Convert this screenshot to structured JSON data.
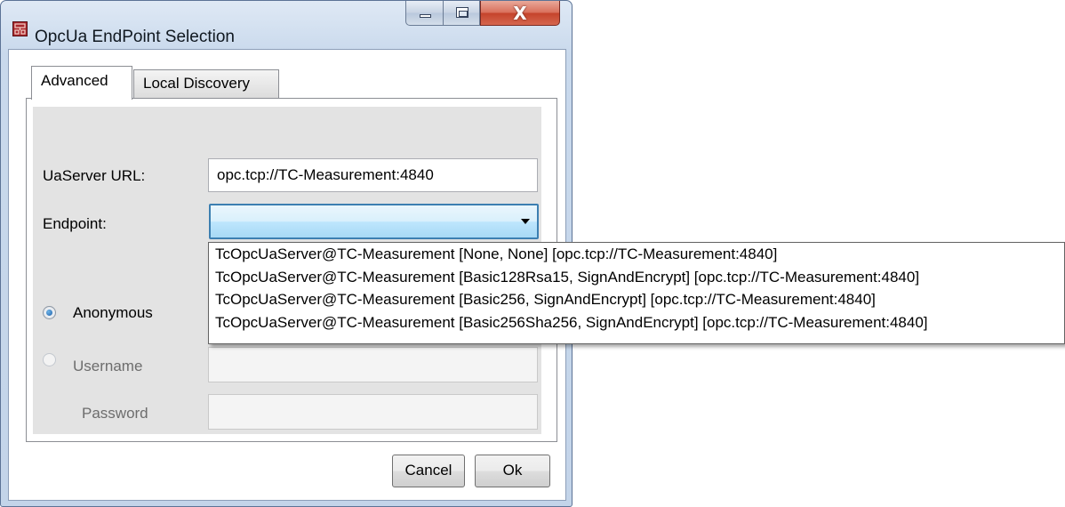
{
  "window": {
    "title": "OpcUa EndPoint Selection",
    "close_glyph": "X"
  },
  "tabs": [
    {
      "label": "Advanced",
      "active": true
    },
    {
      "label": "Local Discovery",
      "active": false
    }
  ],
  "form": {
    "server_url_label": "UaServer URL:",
    "server_url_value": "opc.tcp://TC-Measurement:4840",
    "endpoint_label": "Endpoint:",
    "endpoint_value": "",
    "anonymous_label": "Anonymous",
    "anonymous_selected": true,
    "username_label": "Username",
    "username_value": "",
    "password_label": "Password",
    "password_value": ""
  },
  "endpoint_options": [
    "TcOpcUaServer@TC-Measurement [None, None] [opc.tcp://TC-Measurement:4840]",
    "TcOpcUaServer@TC-Measurement [Basic128Rsa15, SignAndEncrypt] [opc.tcp://TC-Measurement:4840]",
    "TcOpcUaServer@TC-Measurement [Basic256, SignAndEncrypt] [opc.tcp://TC-Measurement:4840]",
    "TcOpcUaServer@TC-Measurement [Basic256Sha256, SignAndEncrypt] [opc.tcp://TC-Measurement:4840]"
  ],
  "buttons": {
    "cancel": "Cancel",
    "ok": "Ok"
  },
  "icons": {
    "app": "network-app-icon",
    "minimize": "minimize-icon",
    "maximize": "maximize-icon",
    "close": "close-icon",
    "dropdown": "chevron-down-icon"
  }
}
